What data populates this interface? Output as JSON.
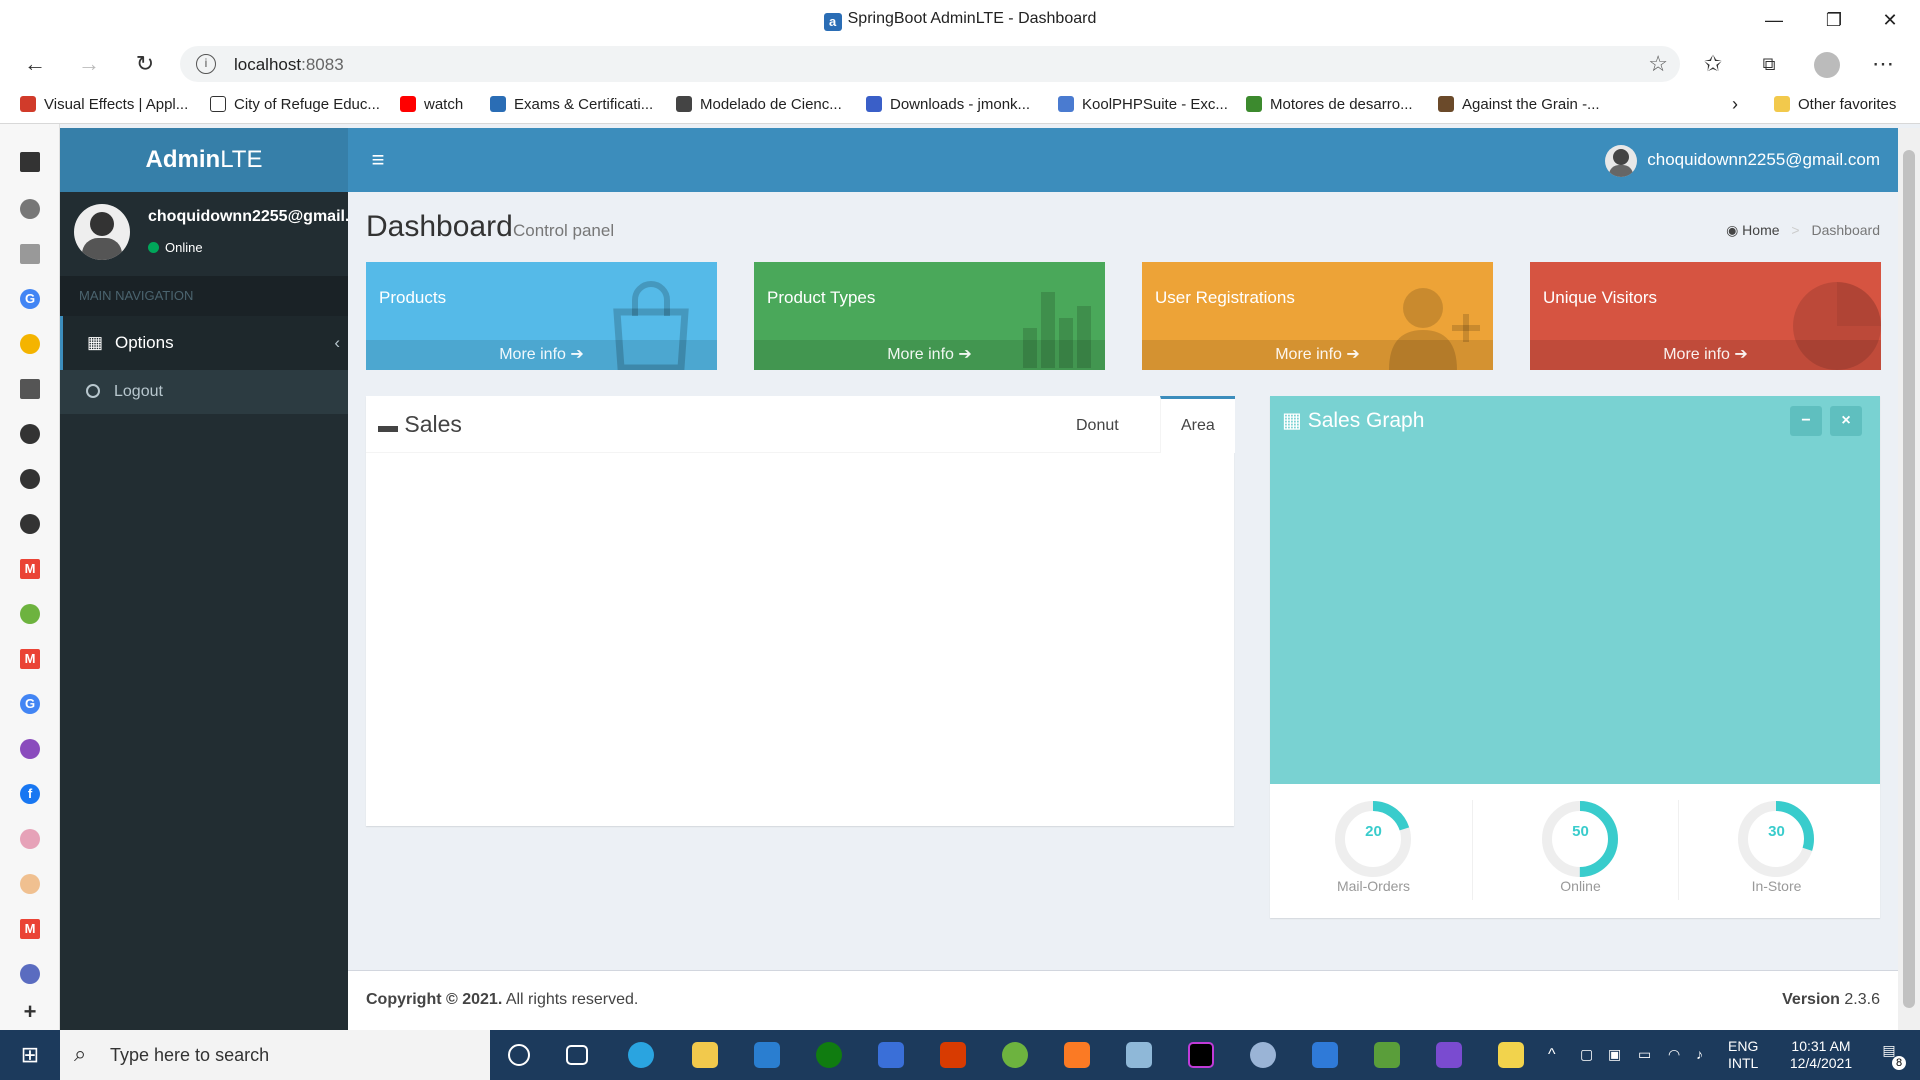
{
  "browser": {
    "title": "SpringBoot AdminLTE - Dashboard",
    "url_host": "localhost",
    "url_port": ":8083",
    "bookmarks": [
      {
        "label": "Visual Effects | Appl...",
        "color": "#d13b2a"
      },
      {
        "label": "City of Refuge Educ...",
        "color": "#ffffff"
      },
      {
        "label": "watch",
        "color": "#ff0000"
      },
      {
        "label": "Exams & Certificati...",
        "color": "#2a6db5"
      },
      {
        "label": "Modelado de Cienc...",
        "color": "#444444"
      },
      {
        "label": "Downloads - jmonk...",
        "color": "#3a5fc8"
      },
      {
        "label": "KoolPHPSuite - Exc...",
        "color": "#4a7bd0"
      },
      {
        "label": "Motores de desarro...",
        "color": "#3c8a2e"
      },
      {
        "label": "Against the Grain -...",
        "color": "#6b4a2a"
      }
    ],
    "other_favorites": "Other favorites"
  },
  "header": {
    "logo_bold": "Admin",
    "logo_light": "LTE",
    "user_email": "choquidownn2255@gmail.com"
  },
  "sidebar": {
    "user_name": "choquidownn2255@gmail.com",
    "status": "Online",
    "section_label": "MAIN NAVIGATION",
    "options_label": "Options",
    "logout_label": "Logout"
  },
  "content": {
    "title": "Dashboard",
    "subtitle": "Control panel",
    "breadcrumb_home": "Home",
    "breadcrumb_current": "Dashboard"
  },
  "boxes": [
    {
      "label": "Products",
      "more": "More info",
      "color": "#55bae8"
    },
    {
      "label": "Product Types",
      "more": "More info",
      "color": "#4aa85a"
    },
    {
      "label": "User Registrations",
      "more": "More info",
      "color": "#eda337"
    },
    {
      "label": "Unique Visitors",
      "more": "More info",
      "color": "#d65441"
    }
  ],
  "sales": {
    "title": "Sales",
    "tab_donut": "Donut",
    "tab_area": "Area"
  },
  "sales_graph": {
    "title": "Sales Graph",
    "knobs": [
      {
        "value": "20",
        "label": "Mail-Orders",
        "fraction": 0.2
      },
      {
        "value": "50",
        "label": "Online",
        "fraction": 0.5
      },
      {
        "value": "30",
        "label": "In-Store",
        "fraction": 0.3
      }
    ]
  },
  "footer": {
    "copyright_bold": "Copyright © 2021.",
    "copyright_rest": "All rights reserved.",
    "version_label": "Version",
    "version_number": "2.3.6"
  },
  "taskbar": {
    "search_placeholder": "Type here to search",
    "lang_top": "ENG",
    "lang_bottom": "INTL",
    "time": "10:31 AM",
    "date": "12/4/2021",
    "notifications": "8"
  }
}
